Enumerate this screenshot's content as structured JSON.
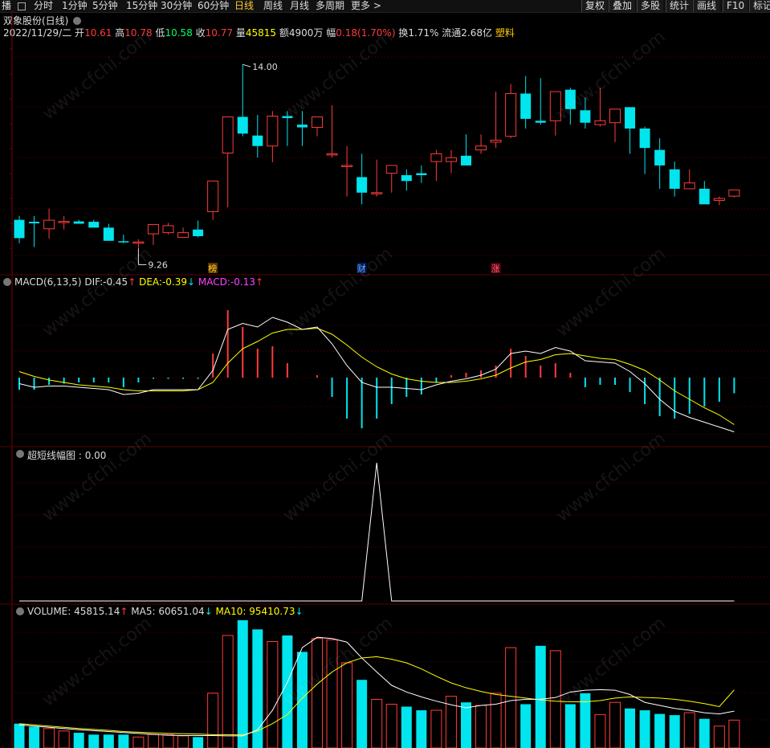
{
  "toolbar": {
    "first": "播",
    "periods": [
      "分时",
      "1分钟",
      "5分钟",
      "15分钟",
      "30分钟",
      "60分钟",
      "日线",
      "周线",
      "月线",
      "多周期",
      "更多 >"
    ],
    "active": "日线",
    "right_buttons": [
      "复权",
      "叠加",
      "多股",
      "统计",
      "画线",
      "F10",
      "标记"
    ]
  },
  "stock": {
    "title": "双象股份(日线)",
    "date": "2022/11/29/二",
    "open_label": "开",
    "open": "10.61",
    "high_label": "高",
    "high": "10.78",
    "low_label": "低",
    "low": "10.58",
    "close_label": "收",
    "close": "10.77",
    "vol_label": "量",
    "vol": "45815",
    "amount_label": "额",
    "amount": "4900万",
    "change_label": "幅",
    "change": "0.18(1.70%)",
    "turnover": "换1.71%",
    "float": "流通2.68亿",
    "sector": "塑料"
  },
  "markers": {
    "bang": "榜",
    "cai": "财",
    "zhang": "涨"
  },
  "price_labels": {
    "max": "14.00",
    "min": "9.26"
  },
  "macd": {
    "name": "MACD(6,13,5)",
    "dif_label": "DIF:",
    "dif": "-0.45",
    "dif_arrow": "↑",
    "dea_label": "DEA:",
    "dea": "-0.39",
    "dea_arrow": "↓",
    "macd_label": "MACD:",
    "macd": "-0.13",
    "macd_arrow": "↑"
  },
  "short_line": {
    "name": "超短线幅图",
    "value": ": 0.00"
  },
  "volume": {
    "vol_label": "VOLUME:",
    "vol": "45815.14",
    "vol_arrow": "↑",
    "ma5_label": "MA5:",
    "ma5": "60651.04",
    "ma5_arrow": "↓",
    "ma10_label": "MA10:",
    "ma10": "95410.73",
    "ma10_arrow": "↓"
  },
  "watermark": "www.cfchi.com",
  "colors": {
    "up": "#ff3b3b",
    "down": "#00e5ee",
    "dif": "#ffffff",
    "dea": "#ffff00",
    "macd": "#ff44ff",
    "bg": "#000000",
    "grid": "#7a0000"
  },
  "chart_data": [
    {
      "type": "candlestick",
      "title": "双象股份(日线)",
      "x": [
        1,
        2,
        3,
        4,
        5,
        6,
        7,
        8,
        9,
        10,
        11,
        12,
        13,
        14,
        15,
        16,
        17,
        18,
        19,
        20,
        21,
        22,
        23,
        24,
        25,
        26,
        27,
        28,
        29,
        30,
        31,
        32,
        33,
        34,
        35,
        36,
        37,
        38,
        39,
        40,
        41,
        42,
        43,
        44,
        45,
        46,
        47,
        48,
        49
      ],
      "open": [
        10.0,
        9.95,
        9.77,
        9.96,
        9.96,
        9.95,
        9.8,
        9.45,
        9.43,
        9.64,
        9.67,
        9.55,
        9.75,
        10.21,
        11.72,
        12.65,
        12.17,
        11.9,
        12.67,
        12.45,
        12.38,
        11.7,
        11.39,
        11.1,
        10.7,
        11.2,
        11.15,
        11.2,
        11.5,
        11.5,
        11.65,
        11.8,
        12.0,
        12.15,
        13.25,
        12.55,
        12.55,
        13.35,
        12.82,
        12.45,
        12.5,
        12.9,
        12.35,
        11.8,
        11.3,
        10.8,
        10.8,
        10.5,
        10.61
      ],
      "high": [
        10.1,
        10.1,
        10.29,
        10.1,
        10.0,
        10.0,
        9.9,
        9.62,
        9.5,
        9.8,
        9.92,
        9.8,
        9.98,
        10.68,
        12.0,
        14.0,
        12.7,
        12.8,
        12.8,
        12.8,
        12.55,
        12.95,
        11.9,
        11.7,
        11.55,
        11.4,
        11.3,
        11.4,
        11.8,
        11.8,
        12.2,
        12.2,
        13.3,
        13.5,
        13.7,
        13.65,
        13.3,
        13.4,
        13.15,
        13.4,
        12.7,
        12.7,
        12.4,
        12.1,
        11.5,
        11.3,
        11.0,
        10.6,
        10.78
      ],
      "low": [
        9.4,
        9.3,
        9.52,
        9.75,
        9.92,
        9.92,
        9.79,
        9.4,
        9.26,
        9.35,
        9.62,
        9.55,
        9.55,
        10.0,
        10.32,
        12.15,
        11.6,
        11.48,
        11.9,
        11.9,
        12.15,
        11.6,
        10.6,
        10.4,
        10.6,
        10.7,
        10.75,
        10.95,
        11.0,
        11.2,
        11.45,
        11.7,
        11.85,
        12.1,
        12.35,
        12.45,
        12.17,
        12.45,
        12.35,
        12.4,
        12.0,
        11.7,
        11.18,
        10.8,
        10.6,
        10.8,
        10.4,
        10.38,
        10.58
      ],
      "close": [
        9.53,
        9.91,
        9.99,
        9.96,
        9.9,
        9.8,
        9.46,
        9.43,
        9.43,
        9.88,
        9.85,
        9.67,
        9.58,
        11.0,
        12.65,
        12.22,
        11.9,
        12.67,
        12.62,
        12.38,
        12.65,
        11.7,
        11.4,
        10.7,
        10.7,
        11.4,
        11.0,
        11.15,
        11.7,
        11.6,
        11.4,
        11.9,
        12.05,
        13.25,
        12.6,
        12.5,
        13.3,
        12.85,
        12.5,
        12.55,
        12.85,
        12.35,
        11.85,
        11.4,
        10.8,
        10.95,
        10.4,
        10.55,
        10.77
      ],
      "ylim": [
        9.0,
        14.5
      ]
    },
    {
      "type": "line",
      "name": "MACD(6,13,5)",
      "series": [
        {
          "name": "DIF",
          "values": [
            -0.05,
            -0.08,
            -0.07,
            -0.07,
            -0.08,
            -0.09,
            -0.1,
            -0.14,
            -0.13,
            -0.1,
            -0.1,
            -0.1,
            -0.1,
            0.06,
            0.4,
            0.45,
            0.42,
            0.5,
            0.46,
            0.4,
            0.42,
            0.28,
            0.1,
            -0.04,
            -0.08,
            -0.08,
            -0.09,
            -0.1,
            -0.06,
            -0.03,
            -0.01,
            0.02,
            0.07,
            0.2,
            0.22,
            0.2,
            0.25,
            0.22,
            0.14,
            0.13,
            0.12,
            0.05,
            -0.05,
            -0.18,
            -0.28,
            -0.33,
            -0.37,
            -0.41,
            -0.45
          ]
        },
        {
          "name": "DEA",
          "values": [
            0.05,
            0.01,
            -0.02,
            -0.04,
            -0.06,
            -0.07,
            -0.08,
            -0.1,
            -0.11,
            -0.11,
            -0.11,
            -0.11,
            -0.1,
            -0.04,
            0.12,
            0.24,
            0.3,
            0.37,
            0.4,
            0.4,
            0.41,
            0.36,
            0.27,
            0.17,
            0.09,
            0.03,
            -0.01,
            -0.03,
            -0.04,
            -0.04,
            -0.03,
            -0.01,
            0.02,
            0.08,
            0.13,
            0.15,
            0.19,
            0.2,
            0.18,
            0.16,
            0.15,
            0.11,
            0.06,
            -0.02,
            -0.11,
            -0.18,
            -0.25,
            -0.31,
            -0.39
          ]
        },
        {
          "name": "MACD",
          "values": [
            -0.1,
            -0.1,
            -0.06,
            -0.05,
            -0.04,
            -0.04,
            -0.04,
            -0.08,
            -0.04,
            -0.01,
            -0.01,
            -0.01,
            -0.01,
            0.2,
            0.56,
            0.42,
            0.24,
            0.26,
            0.12,
            0.0,
            0.02,
            -0.16,
            -0.34,
            -0.42,
            -0.34,
            -0.22,
            -0.16,
            -0.14,
            -0.04,
            0.02,
            0.04,
            0.06,
            0.1,
            0.24,
            0.18,
            0.1,
            0.12,
            0.04,
            -0.08,
            -0.06,
            -0.06,
            -0.12,
            -0.22,
            -0.32,
            -0.34,
            -0.3,
            -0.24,
            -0.2,
            -0.13
          ]
        }
      ]
    },
    {
      "type": "line",
      "name": "超短线幅图",
      "values": [
        0,
        0,
        0,
        0,
        0,
        0,
        0,
        0,
        0,
        0,
        0,
        0,
        0,
        0,
        0,
        0,
        0,
        0,
        0,
        0,
        0,
        0,
        0,
        0,
        1,
        0,
        0,
        0,
        0,
        0,
        0,
        0,
        0,
        0,
        0,
        0,
        0,
        0,
        0,
        0,
        0,
        0,
        0,
        0,
        0,
        0,
        0,
        0,
        0
      ]
    },
    {
      "type": "bar",
      "name": "VOLUME",
      "values": [
        40000,
        35000,
        32000,
        28000,
        25000,
        22000,
        22000,
        22000,
        18000,
        22000,
        22000,
        20000,
        18000,
        90000,
        185000,
        210000,
        195000,
        175000,
        185000,
        158000,
        180000,
        178000,
        140000,
        112000,
        80000,
        72000,
        68000,
        62000,
        62000,
        85000,
        75000,
        70000,
        90000,
        165000,
        72000,
        168000,
        160000,
        72000,
        90000,
        55000,
        75000,
        65000,
        62000,
        56000,
        54000,
        58000,
        48000,
        36000,
        45815
      ],
      "ma5": [
        38000,
        36000,
        34000,
        32000,
        30000,
        28500,
        27000,
        25500,
        24000,
        22500,
        21000,
        20500,
        20500,
        20500,
        20000,
        20000,
        30000,
        62000,
        108000,
        165000,
        182000,
        180000,
        174000,
        148000,
        125000,
        103000,
        92000,
        84000,
        77000,
        71000,
        66000,
        70000,
        72000,
        78000,
        80000,
        80000,
        83000,
        92000,
        95000,
        96000,
        95000,
        88000,
        75000,
        70000,
        65000,
        62000,
        58000,
        56000,
        60651
      ],
      "ma10": [
        40000,
        38000,
        36000,
        34000,
        32000,
        30500,
        29000,
        27000,
        26000,
        25000,
        24000,
        23500,
        23000,
        22000,
        22000,
        21500,
        28000,
        40000,
        55000,
        82000,
        105000,
        125000,
        140000,
        148000,
        150000,
        146000,
        140000,
        130000,
        118000,
        107000,
        99000,
        93000,
        88000,
        85000,
        82000,
        79000,
        77000,
        76000,
        76000,
        78000,
        82000,
        84000,
        83000,
        82000,
        80000,
        77000,
        73000,
        68000,
        95410.73
      ]
    }
  ]
}
